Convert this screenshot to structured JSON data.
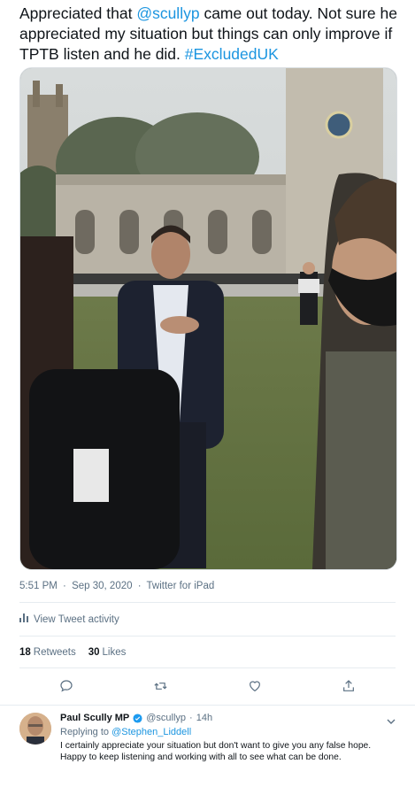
{
  "tweet": {
    "text_part1": "Appreciated that ",
    "mention": "@scullyp",
    "text_part2": " came out today. Not sure he appreciated my situation but things can only improve if TPTB listen and he did. ",
    "hashtag": "#ExcludedUK",
    "time": "5:51 PM",
    "separator": "·",
    "date": "Sep 30, 2020",
    "source": "Twitter for iPad"
  },
  "activity": {
    "label": "View Tweet activity",
    "icon": "bar-chart-icon"
  },
  "stats": {
    "retweets_count": "18",
    "retweets_label": "Retweets",
    "likes_count": "30",
    "likes_label": "Likes"
  },
  "actions": [
    {
      "name": "reply-button",
      "icon": "comment-icon"
    },
    {
      "name": "retweet-button",
      "icon": "retweet-icon"
    },
    {
      "name": "like-button",
      "icon": "heart-icon"
    },
    {
      "name": "share-button",
      "icon": "share-icon"
    }
  ],
  "reply": {
    "name": "Paul Scully MP",
    "handle": "@scullyp",
    "separator": "·",
    "time": "14h",
    "replying_prefix": "Replying to ",
    "replying_to": "@Stephen_Liddell",
    "text": "I certainly appreciate your situation but don't want to give you any false hope. Happy to keep listening and working with all to see what can be done."
  },
  "colors": {
    "link": "#1b95e0",
    "secondary": "#5b7083",
    "text": "#0f1419",
    "border": "#e6ecf0"
  }
}
